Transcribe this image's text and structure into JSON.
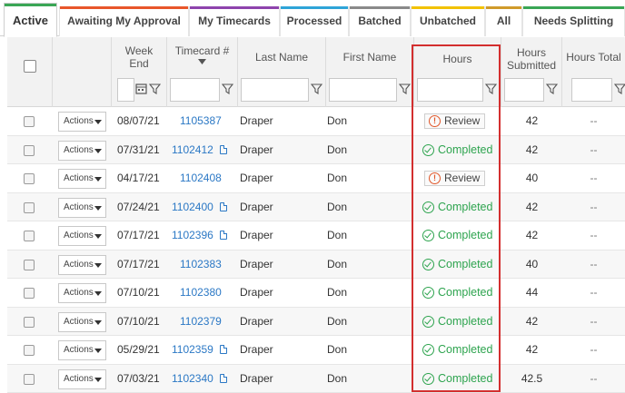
{
  "tabs": [
    {
      "label": "Active",
      "color": "#3aa655",
      "active": true
    },
    {
      "label": "Awaiting My Approval",
      "color": "#e8562a",
      "active": false
    },
    {
      "label": "My Timecards",
      "color": "#8e44ad",
      "active": false
    },
    {
      "label": "Processed",
      "color": "#2fa4d8",
      "active": false
    },
    {
      "label": "Batched",
      "color": "#8a8a8a",
      "active": false
    },
    {
      "label": "Unbatched",
      "color": "#f2c200",
      "active": false
    },
    {
      "label": "All",
      "color": "#d09a2a",
      "active": false
    },
    {
      "label": "Needs Splitting",
      "color": "#3aa655",
      "active": false
    }
  ],
  "columns": {
    "week_end": "Week End",
    "timecard": "Timecard #",
    "last_name": "Last Name",
    "first_name": "First Name",
    "hours": "Hours",
    "hours_submitted": "Hours Submitted",
    "hours_total": "Hours Total"
  },
  "actions_label": "Actions",
  "rows": [
    {
      "week_end": "08/07/21",
      "timecard": "1105387",
      "doc": false,
      "last": "Draper",
      "first": "Don",
      "status": "Review",
      "submitted": "42",
      "total": "--"
    },
    {
      "week_end": "07/31/21",
      "timecard": "1102412",
      "doc": true,
      "last": "Draper",
      "first": "Don",
      "status": "Completed",
      "submitted": "42",
      "total": "--"
    },
    {
      "week_end": "04/17/21",
      "timecard": "1102408",
      "doc": false,
      "last": "Draper",
      "first": "Don",
      "status": "Review",
      "submitted": "40",
      "total": "--"
    },
    {
      "week_end": "07/24/21",
      "timecard": "1102400",
      "doc": true,
      "last": "Draper",
      "first": "Don",
      "status": "Completed",
      "submitted": "42",
      "total": "--"
    },
    {
      "week_end": "07/17/21",
      "timecard": "1102396",
      "doc": true,
      "last": "Draper",
      "first": "Don",
      "status": "Completed",
      "submitted": "42",
      "total": "--"
    },
    {
      "week_end": "07/17/21",
      "timecard": "1102383",
      "doc": false,
      "last": "Draper",
      "first": "Don",
      "status": "Completed",
      "submitted": "40",
      "total": "--"
    },
    {
      "week_end": "07/10/21",
      "timecard": "1102380",
      "doc": false,
      "last": "Draper",
      "first": "Don",
      "status": "Completed",
      "submitted": "44",
      "total": "--"
    },
    {
      "week_end": "07/10/21",
      "timecard": "1102379",
      "doc": false,
      "last": "Draper",
      "first": "Don",
      "status": "Completed",
      "submitted": "42",
      "total": "--"
    },
    {
      "week_end": "05/29/21",
      "timecard": "1102359",
      "doc": true,
      "last": "Draper",
      "first": "Don",
      "status": "Completed",
      "submitted": "42",
      "total": "--"
    },
    {
      "week_end": "07/03/21",
      "timecard": "1102340",
      "doc": true,
      "last": "Draper",
      "first": "Don",
      "status": "Completed",
      "submitted": "42.5",
      "total": "--"
    }
  ],
  "colors": {
    "link": "#2b78c5",
    "completed": "#2ea44f",
    "review": "#e0572a",
    "highlight": "#d32f2f"
  }
}
